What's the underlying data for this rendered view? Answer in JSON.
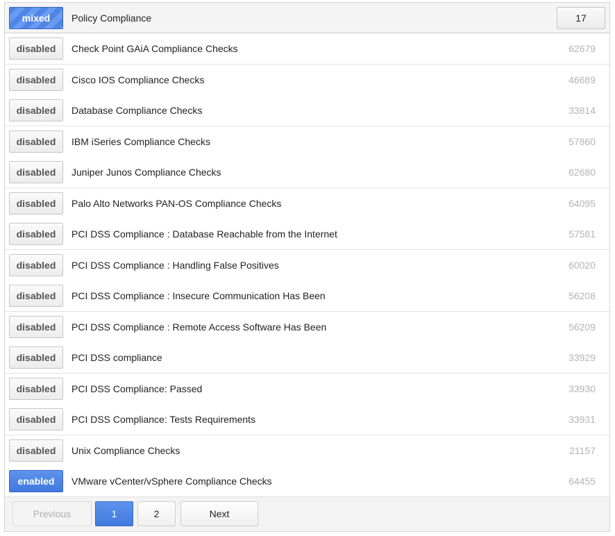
{
  "header": {
    "status": "mixed",
    "title": "Policy Compliance",
    "count": "17"
  },
  "rows": [
    {
      "status": "disabled",
      "name": "Check Point GAiA Compliance Checks",
      "id": "62679"
    },
    {
      "status": "disabled",
      "name": "Cisco IOS Compliance Checks",
      "id": "46689"
    },
    {
      "status": "disabled",
      "name": "Database Compliance Checks",
      "id": "33814"
    },
    {
      "status": "disabled",
      "name": "IBM iSeries Compliance Checks",
      "id": "57860"
    },
    {
      "status": "disabled",
      "name": "Juniper Junos Compliance Checks",
      "id": "62680"
    },
    {
      "status": "disabled",
      "name": "Palo Alto Networks PAN-OS Compliance Checks",
      "id": "64095"
    },
    {
      "status": "disabled",
      "name": "PCI DSS Compliance : Database Reachable from the Internet",
      "id": "57581"
    },
    {
      "status": "disabled",
      "name": "PCI DSS Compliance : Handling False Positives",
      "id": "60020"
    },
    {
      "status": "disabled",
      "name": "PCI DSS Compliance : Insecure Communication Has Been",
      "id": "56208"
    },
    {
      "status": "disabled",
      "name": "PCI DSS Compliance : Remote Access Software Has Been",
      "id": "56209"
    },
    {
      "status": "disabled",
      "name": "PCI DSS compliance",
      "id": "33929"
    },
    {
      "status": "disabled",
      "name": "PCI DSS Compliance: Passed",
      "id": "33930"
    },
    {
      "status": "disabled",
      "name": "PCI DSS Compliance: Tests Requirements",
      "id": "33931"
    },
    {
      "status": "disabled",
      "name": "Unix Compliance Checks",
      "id": "21157"
    },
    {
      "status": "enabled",
      "name": "VMware vCenter/vSphere Compliance Checks",
      "id": "64455"
    }
  ],
  "pagination": {
    "previous": "Previous",
    "pages": [
      "1",
      "2"
    ],
    "current": "1",
    "next": "Next"
  },
  "colors": {
    "accent": "#4a80e6",
    "muted_id": "#b4b4b4"
  }
}
